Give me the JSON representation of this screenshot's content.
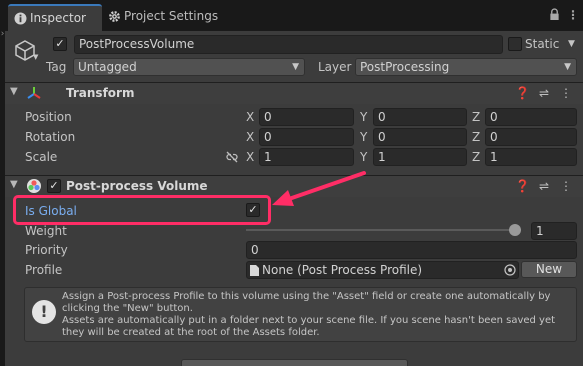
{
  "tabs": [
    {
      "label": "Inspector",
      "icon": "info-icon"
    },
    {
      "label": "Project Settings",
      "icon": "gear-icon"
    }
  ],
  "object": {
    "name": "PostProcessVolume",
    "static_label": "Static",
    "tag_label": "Tag",
    "tag_value": "Untagged",
    "layer_label": "Layer",
    "layer_value": "PostProcessing"
  },
  "transform": {
    "title": "Transform",
    "rows": [
      {
        "label": "Position",
        "x": "0",
        "y": "0",
        "z": "0"
      },
      {
        "label": "Rotation",
        "x": "0",
        "y": "0",
        "z": "0"
      },
      {
        "label": "Scale",
        "x": "1",
        "y": "1",
        "z": "1"
      }
    ]
  },
  "volume": {
    "title": "Post-process Volume",
    "is_global_label": "Is Global",
    "weight_label": "Weight",
    "weight_value": "1",
    "weight_level": 1.0,
    "priority_label": "Priority",
    "priority_value": "0",
    "profile_label": "Profile",
    "profile_value": "None (Post Process Profile)",
    "new_button": "New",
    "help_text": "Assign a Post-process Profile to this volume using the \"Asset\" field or create one automatically by clicking the \"New\" button.\nAssets are automatically put in a folder next to your scene file. If you scene hasn't been saved yet they will be created at the root of the Assets folder."
  },
  "axis_labels": {
    "x": "X",
    "y": "Y",
    "z": "Z"
  },
  "colors": {
    "accent_blue": "#3a79bb",
    "highlight": "#ff2d66",
    "is_global_text": "#7aaef0"
  }
}
